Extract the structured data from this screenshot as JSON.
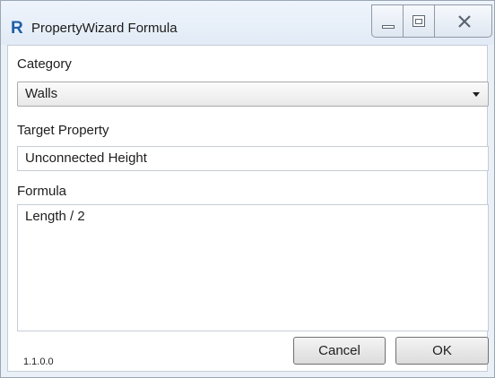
{
  "window": {
    "title": "PropertyWizard Formula",
    "app_icon_letter": "R",
    "controls": [
      "minimize-icon",
      "maximize-icon",
      "close-icon"
    ]
  },
  "form": {
    "category": {
      "label": "Category",
      "selected": "Walls"
    },
    "target_property": {
      "label": "Target Property",
      "value": "Unconnected Height"
    },
    "formula": {
      "label": "Formula",
      "value": "Length / 2"
    }
  },
  "footer": {
    "version": "1.1.0.0",
    "cancel_label": "Cancel",
    "ok_label": "OK"
  },
  "colors": {
    "icon_blue": "#1e5fa8",
    "titlebar": "#e2ebf6"
  }
}
